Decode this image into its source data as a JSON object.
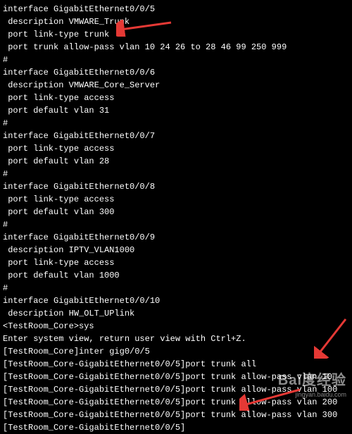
{
  "config": {
    "if005": {
      "name": "interface GigabitEthernet0/0/5",
      "desc": " description VMWARE_Trunk",
      "linktype": " port link-type trunk",
      "allowpass": " port trunk allow-pass vlan 10 24 26 to 28 46 99 250 999"
    },
    "hash1": "#",
    "if006": {
      "name": "interface GigabitEthernet0/0/6",
      "desc": " description VMWARE_Core_Server",
      "linktype": " port link-type access",
      "default": " port default vlan 31"
    },
    "hash2": "#",
    "if007": {
      "name": "interface GigabitEthernet0/0/7",
      "linktype": " port link-type access",
      "default": " port default vlan 28"
    },
    "hash3": "#",
    "if008": {
      "name": "interface GigabitEthernet0/0/8",
      "linktype": " port link-type access",
      "default": " port default vlan 300"
    },
    "hash4": "#",
    "if009": {
      "name": "interface GigabitEthernet0/0/9",
      "desc": " description IPTV_VLAN1000",
      "linktype": " port link-type access",
      "default": " port default vlan 1000"
    },
    "hash5": "#",
    "if010": {
      "name": "interface GigabitEthernet0/0/10",
      "desc": " description HW_OLT_UPlink"
    }
  },
  "session": {
    "blank": "",
    "prompt1": "<TestRoom_Core>sys",
    "sysview": "Enter system view, return user view with Ctrl+Z.",
    "prompt2": "[TestRoom_Core]inter gig0/0/5",
    "cmd1": "[TestRoom_Core-GigabitEthernet0/0/5]port trunk all",
    "cmd2": "[TestRoom_Core-GigabitEthernet0/0/5]port trunk allow-pass vlan 10",
    "cmd3": "[TestRoom_Core-GigabitEthernet0/0/5]port trunk allow-pass vlan 100",
    "cmd4": "[TestRoom_Core-GigabitEthernet0/0/5]port trunk allow-pass vlan 200",
    "cmd5": "[TestRoom_Core-GigabitEthernet0/0/5]port trunk allow-pass vlan 300",
    "cmd6": "[TestRoom_Core-GigabitEthernet0/0/5]"
  },
  "watermark": {
    "main": "Bai度经验",
    "sub": "jingyan.baidu.com"
  }
}
